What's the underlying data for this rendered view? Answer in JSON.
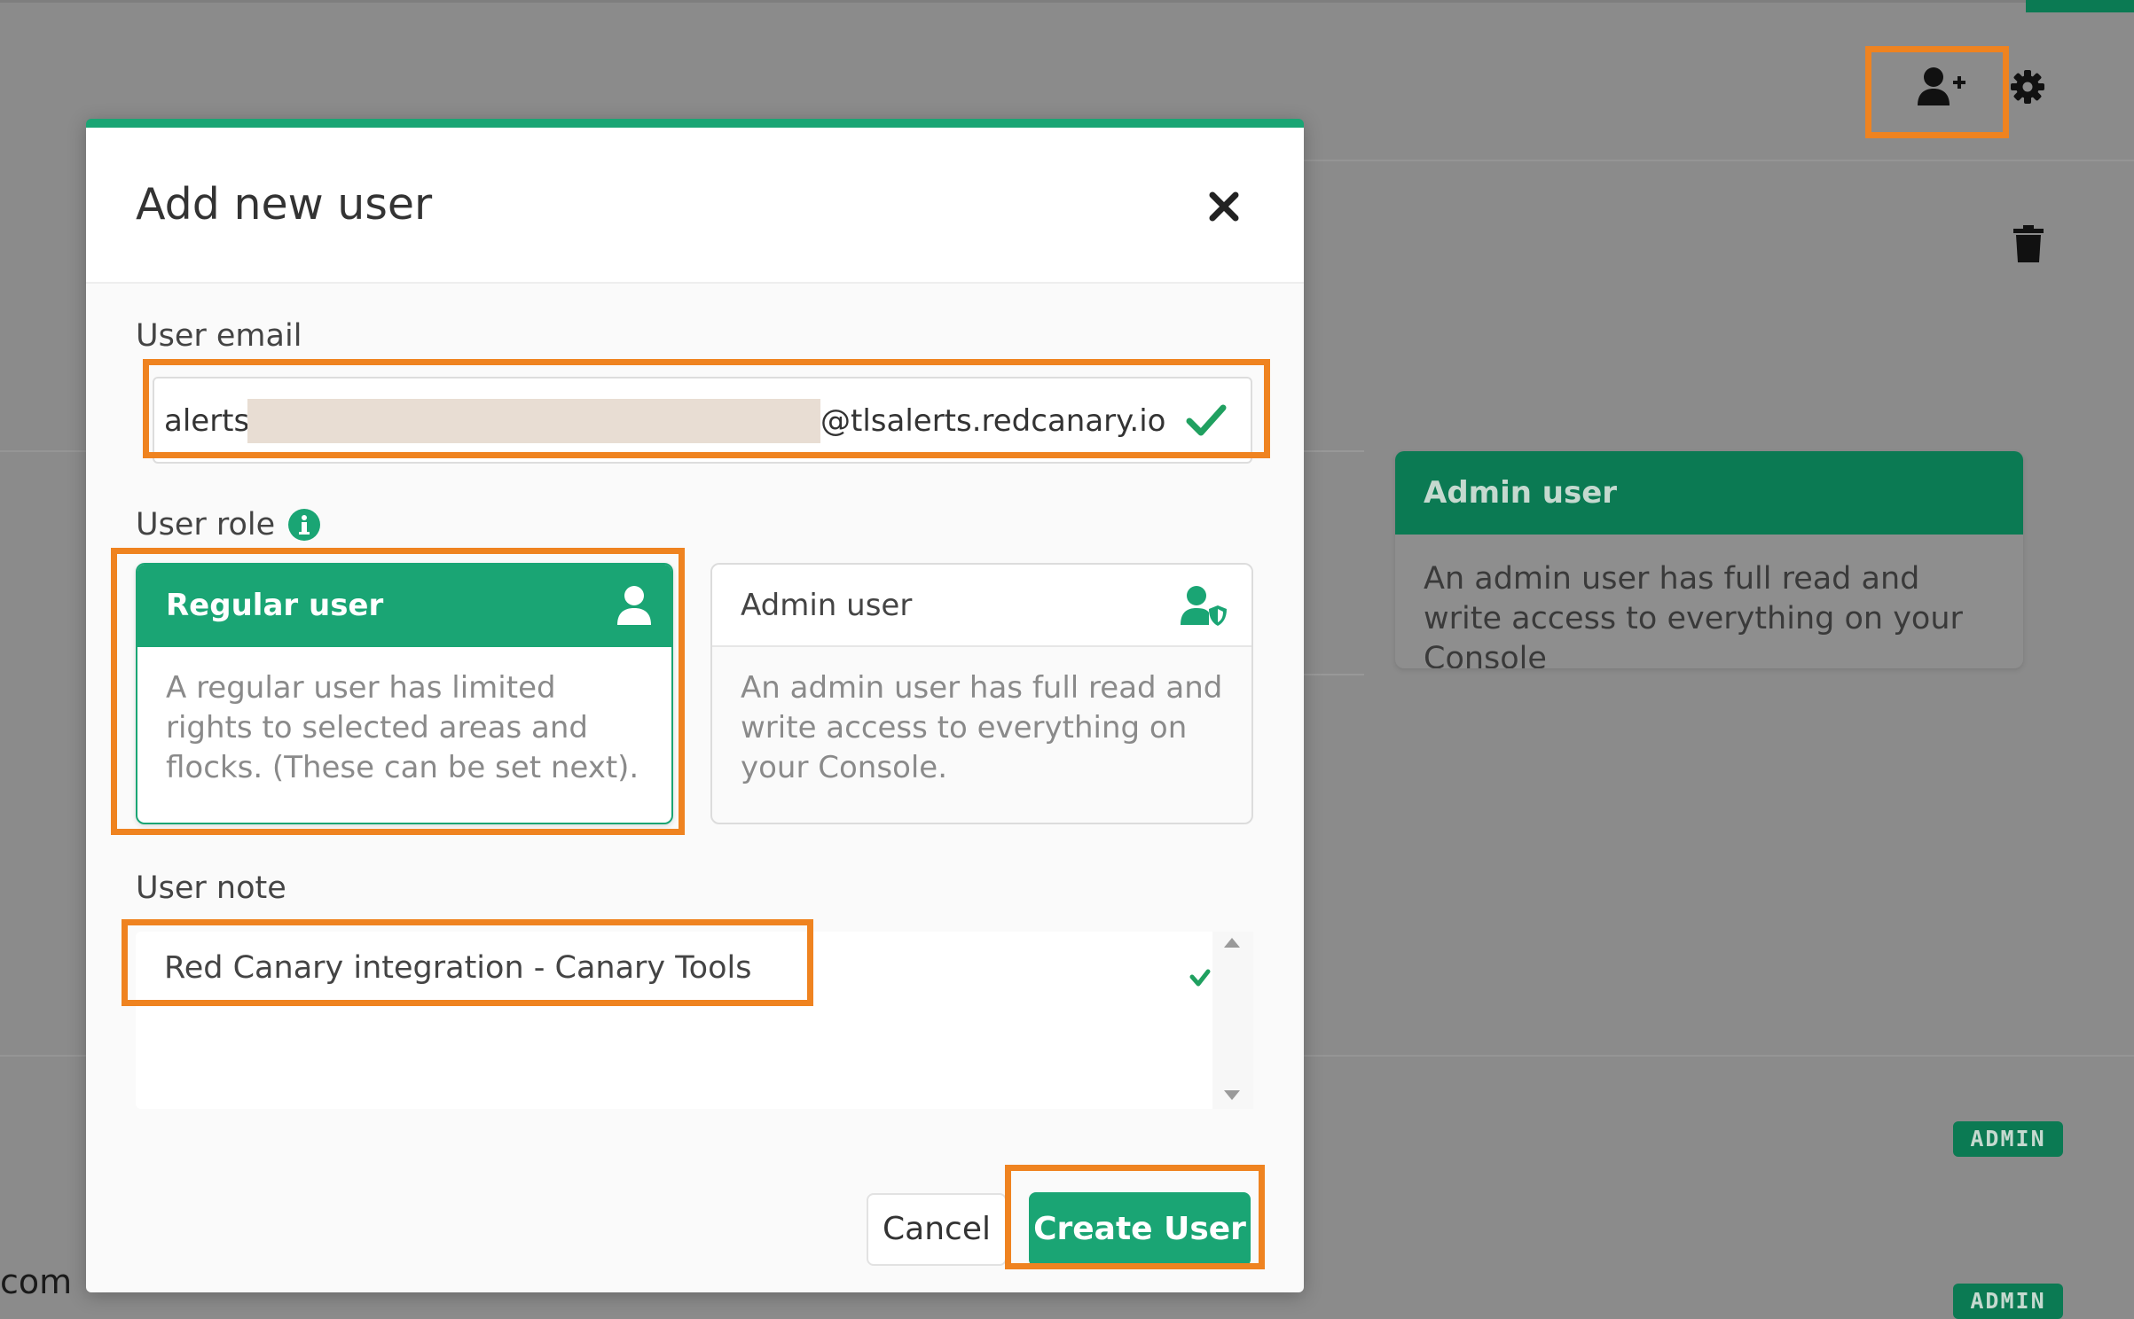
{
  "background": {
    "admin_card": {
      "title": "Admin user",
      "description": "An admin user has full read and write access to everything on your Console"
    },
    "badges": [
      "ADMIN",
      "ADMIN"
    ],
    "partial_text": "com",
    "icons": [
      "add-user-icon",
      "gear-icon",
      "trash-icon"
    ]
  },
  "modal": {
    "title": "Add new user",
    "close_icon": "close-icon",
    "email": {
      "label": "User email",
      "prefix": "alerts",
      "suffix": "@tlsalerts.redcanary.io",
      "valid_icon": "check-icon"
    },
    "role": {
      "label": "User role",
      "info_icon": "info-icon",
      "options": [
        {
          "title": "Regular user",
          "description": "A regular user has limited rights to selected areas and flocks. (These can be set next).",
          "icon": "user-icon",
          "selected": true
        },
        {
          "title": "Admin user",
          "description": "An admin user has full read and write access to everything on your Console.",
          "icon": "user-shield-icon",
          "selected": false
        }
      ]
    },
    "note": {
      "label": "User note",
      "value": "Red Canary integration - Canary Tools"
    },
    "buttons": {
      "cancel": "Cancel",
      "create": "Create User"
    }
  },
  "colors": {
    "accent": "#1aa574",
    "highlight": "#ef8320",
    "dark_green": "#0b7a53"
  }
}
